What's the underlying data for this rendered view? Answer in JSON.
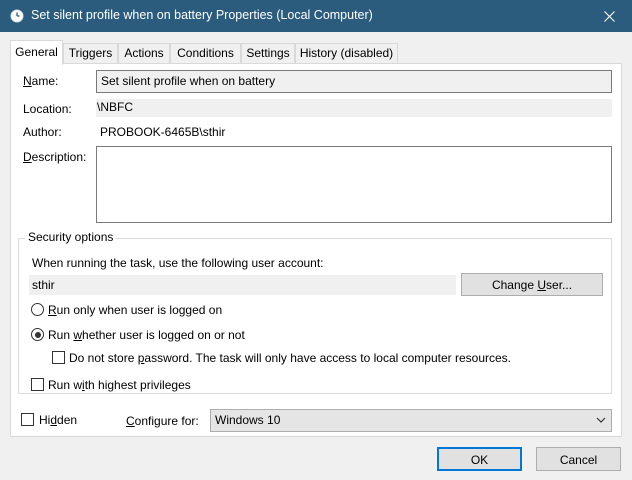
{
  "window": {
    "title": "Set silent profile when on battery Properties (Local Computer)",
    "close_glyph": "✕"
  },
  "tabs": [
    {
      "label": "General",
      "active": true
    },
    {
      "label": "Triggers",
      "active": false
    },
    {
      "label": "Actions",
      "active": false
    },
    {
      "label": "Conditions",
      "active": false
    },
    {
      "label": "Settings",
      "active": false
    },
    {
      "label": "History (disabled)",
      "active": false
    }
  ],
  "general": {
    "name_label": "Name:",
    "name_value": "Set silent profile when on battery",
    "location_label": "Location:",
    "location_value": "\\NBFC",
    "author_label": "Author:",
    "author_value": "PROBOOK-6465B\\sthir",
    "description_label": "Description:",
    "description_value": ""
  },
  "security": {
    "group_title": "Security options",
    "account_prompt": "When running the task, use the following user account:",
    "user_account": "sthir",
    "change_user_label": "Change User...",
    "radio_logged_on": {
      "label": "Run only when user is logged on",
      "checked": false
    },
    "radio_whether": {
      "label": "Run whether user is logged on or not",
      "checked": true
    },
    "check_no_store_password": {
      "label": "Do not store password.  The task will only have access to local computer resources.",
      "checked": false
    },
    "check_highest_privileges": {
      "label": "Run with highest privileges",
      "checked": false
    }
  },
  "bottom": {
    "hidden_label": "Hidden",
    "hidden_checked": false,
    "configure_label": "Configure for:",
    "configure_value": "Windows 10"
  },
  "buttons": {
    "ok_label": "OK",
    "cancel_label": "Cancel"
  },
  "colors": {
    "titlebar": "#2b5c7e",
    "default_button_border": "#0078d7"
  }
}
